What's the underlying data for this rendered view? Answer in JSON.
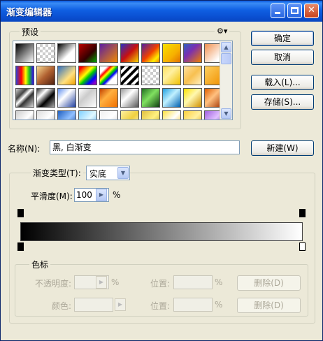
{
  "window": {
    "title": "渐变编辑器"
  },
  "presets": {
    "label": "预设",
    "menu_icon": "gear-menu-icon",
    "swatches": [
      "linear-gradient(135deg,#000 0%,#fff 100%)",
      "checker-black",
      "linear-gradient(135deg,#000 0%,#fff 60%)",
      "linear-gradient(135deg,#b00 0%,#300 60%,#0a0 100%)",
      "linear-gradient(135deg,#5b1fa0 0%,#f28a00 100%)",
      "linear-gradient(135deg,#2a30c0 0%,#c71010 50%,#f5d800 100%)",
      "linear-gradient(135deg,#5020a0 0%,#f04000 50%,#ffee00 80%,#f08000 100%)",
      "linear-gradient(135deg,#f7e000 0%,#f7b000 60%,#e07000 100%)",
      "linear-gradient(135deg,#2f60c0 0%,#7a2fb0 40%,#f08000 100%)",
      "linear-gradient(135deg,#f09050 0%,#fff 80%)",
      "linear-gradient(90deg,#3040d0 0%,#f00 30%,#ff0 55%,#20c020 75%,#30f 100%)",
      "linear-gradient(135deg,#f8d890 0%,#b06030 50%,#502010 100%)",
      "linear-gradient(135deg,#3070c0 0%,#ffe080 60%,#f0a000 100%)",
      "linear-gradient(135deg,#ff0000 10%,#ff8800 25%,#ffff00 40%,#00cc00 55%,#0000ff 75%,#8800cc 90%)",
      "linear-gradient(135deg,#fff 20%,#f00 30%,#ff0 40%,#0c0 50%,#00f 60%,#fff 70%)",
      "repeating-linear-gradient(135deg,#000 0 4px,#fff 4px 8px)",
      "checker",
      "linear-gradient(135deg,#ffe060 0%,#fff0a0 40%,#f0c000 100%)",
      "linear-gradient(135deg,#ffe0a0 0%,#f8c050 50%,#fff0c0 100%)",
      "linear-gradient(135deg,#ffd060 0%,#f09000 100%)",
      "linear-gradient(135deg,#ccc 0%,#444 30%,#fff 45%,#333 60%,#ddd 100%)",
      "linear-gradient(135deg,#333 0%,#fff 30%,#000 60%,#aaa 100%)",
      "linear-gradient(135deg,#6090f0 0%,#fff 40%,#2040a0 100%)",
      "linear-gradient(135deg,#fff 0%,#ccc 40%,#fff 100%)",
      "linear-gradient(135deg,#c04000 0%,#ffb040 40%,#f07000 100%)",
      "linear-gradient(135deg,#999 0%,#fff 40%,#555 100%)",
      "linear-gradient(135deg,#207020 0%,#80e060 45%,#104010 100%)",
      "linear-gradient(135deg,#20a0e0 0%,#c0f0ff 45%,#0060b0 100%)",
      "linear-gradient(135deg,#ffe000 0%,#fff8b0 45%,#d09000 100%)",
      "linear-gradient(135deg,#e06000 0%,#ffc080 45%,#a03000 100%)",
      "linear-gradient(135deg,#ccc 0%,#fff 50%,#888 100%)",
      "linear-gradient(135deg,#ddd 0%,#fff 50%,#aaa 100%)",
      "linear-gradient(135deg,#2060c0 0%,#90c0ff 50%,#1040a0 100%)",
      "linear-gradient(135deg,#80d0ff 0%,#e0f8ff 50%,#50b0f0 100%)",
      "linear-gradient(135deg,#f0f0f0 0%,#fff 50%,#d0d0d0 100%)",
      "linear-gradient(135deg,#fff0a0 0%,#f0d040 50%,#fff8d0 100%)",
      "linear-gradient(135deg,#e0c040 0%,#fff080 50%,#c0a020 100%)",
      "linear-gradient(135deg,#ffe040 0%,#fff 50%,#ffc000 100%)",
      "linear-gradient(135deg,#ffd040 0%,#fff0a0 50%,#e0a000 100%)",
      "linear-gradient(135deg,#a060e0 0%,#e0c0ff 50%,#6030b0 100%)"
    ]
  },
  "buttons": {
    "ok": "确定",
    "cancel": "取消",
    "load": "载入(L)...",
    "save": "存储(S)...",
    "new": "新建(W)"
  },
  "name": {
    "label": "名称(N):",
    "value": "黑, 白渐变"
  },
  "gradient": {
    "type_label": "渐变类型(T):",
    "type_value": "实底",
    "smoothness_label": "平滑度(M):",
    "smoothness_value": "100",
    "smoothness_unit": "%",
    "start_color": "#000000",
    "end_color": "#ffffff",
    "opacity_stops": [
      "#000000",
      "#000000"
    ],
    "color_stops": [
      "#000000",
      "#ffffff"
    ]
  },
  "stops": {
    "group_label": "色标",
    "opacity_label": "不透明度:",
    "opacity_unit": "%",
    "opacity_location_label": "位置:",
    "opacity_location_unit": "%",
    "opacity_delete": "删除(D)",
    "color_label": "颜色:",
    "color_location_label": "位置:",
    "color_location_unit": "%",
    "color_delete": "删除(D)"
  }
}
